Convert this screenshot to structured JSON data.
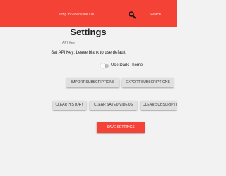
{
  "header": {
    "jump_placeholder": "Jump to Video Link / Id",
    "search_placeholder": "Search",
    "icon": "search-icon"
  },
  "page": {
    "title": "Settings"
  },
  "api_key": {
    "label": "API Key",
    "help": "Set API Key: Leave blank to use default"
  },
  "dark_theme": {
    "label": "Use Dark Theme",
    "enabled": false
  },
  "buttons": {
    "import": "IMPORT SUBSCRIPTIONS",
    "export": "EXPORT SUBSCRIPTIONS",
    "clear_history": "CLEAR HISTORY",
    "clear_saved": "CLEAR SAVED VIDEOS",
    "clear_subs": "CLEAR SUBSCRIPTIONS",
    "save": "SAVE SETTINGS"
  },
  "colors": {
    "accent": "#f44336",
    "background": "#f2f2f2",
    "button": "#e0e0e0"
  }
}
